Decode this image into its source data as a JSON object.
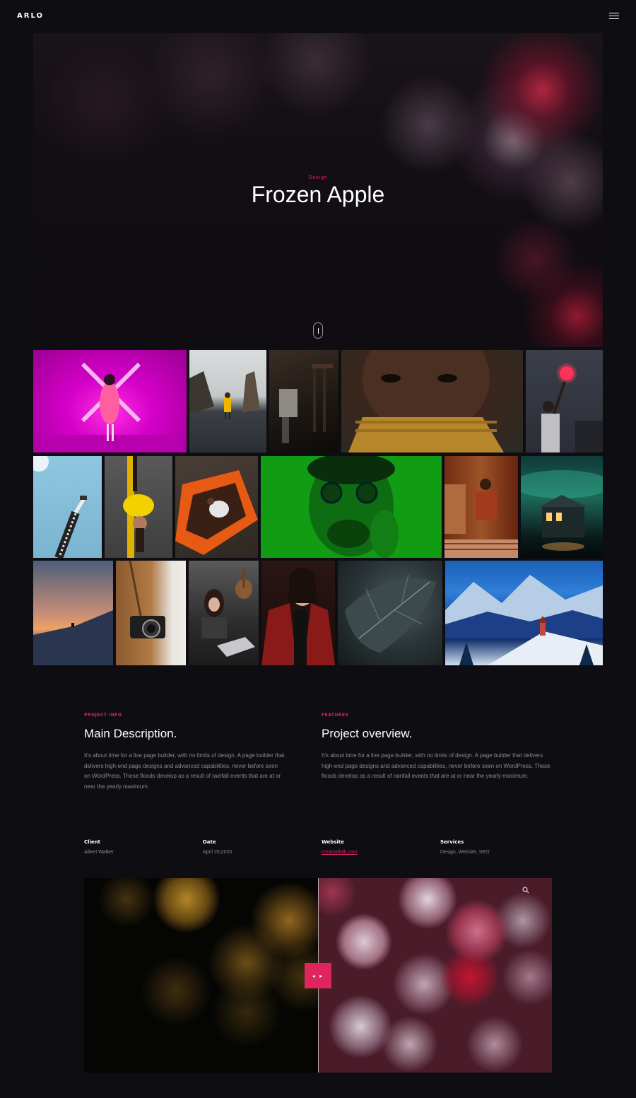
{
  "header": {
    "logo": "ARLO",
    "menu_icon": "hamburger-menu-icon"
  },
  "hero": {
    "category": "Design",
    "title": "Frozen Apple",
    "scroll_icon": "scroll-mouse-icon"
  },
  "gallery": {
    "items": [
      "pink-room-woman",
      "beach-yellow-coat",
      "sitting-stairs-boots",
      "man-portrait-turtleneck",
      "man-neon-heart-sign",
      "legs-in-air-sky",
      "woman-yellow-lying",
      "orange-car-top-view",
      "green-man-sunglasses",
      "woman-red-chair",
      "cabin-aurora",
      "sunset-hill",
      "camera-coat",
      "woman-laptop-guitar",
      "woman-red-jacket",
      "dark-leaf-drops",
      "snowy-mountains-church"
    ]
  },
  "project_info": {
    "label": "PROJECT INFO",
    "heading": "Main Description.",
    "text": "It's about time for a live page builder, with no limits of design. A page builder that delivers high-end page designs and advanced capabilities, never before seen on WordPress. These floods develop as a result of rainfall events that are at or near the yearly maximum."
  },
  "features": {
    "label": "FEATURES",
    "heading": "Project overview.",
    "text": "It's about time for a live page builder, with no limits of design. A page builder that delivers high-end page designs and advanced capabilities, never before seen on WordPress. These floods develop as a result of rainfall events that are at or near the yearly maximum."
  },
  "meta": {
    "client": {
      "label": "Client",
      "value": "Albert Walker"
    },
    "date": {
      "label": "Date",
      "value": "April 20,2020"
    },
    "website": {
      "label": "Website",
      "value": "creativefolk.com"
    },
    "services": {
      "label": "Services",
      "value": "Design, Website, SEO"
    }
  },
  "compare": {
    "handle_icon": "left-right-arrows-icon",
    "zoom_icon": "search-icon",
    "handle_text": "◂ ▸"
  },
  "colors": {
    "accent": "#e0245e",
    "background": "#0d0d12"
  }
}
